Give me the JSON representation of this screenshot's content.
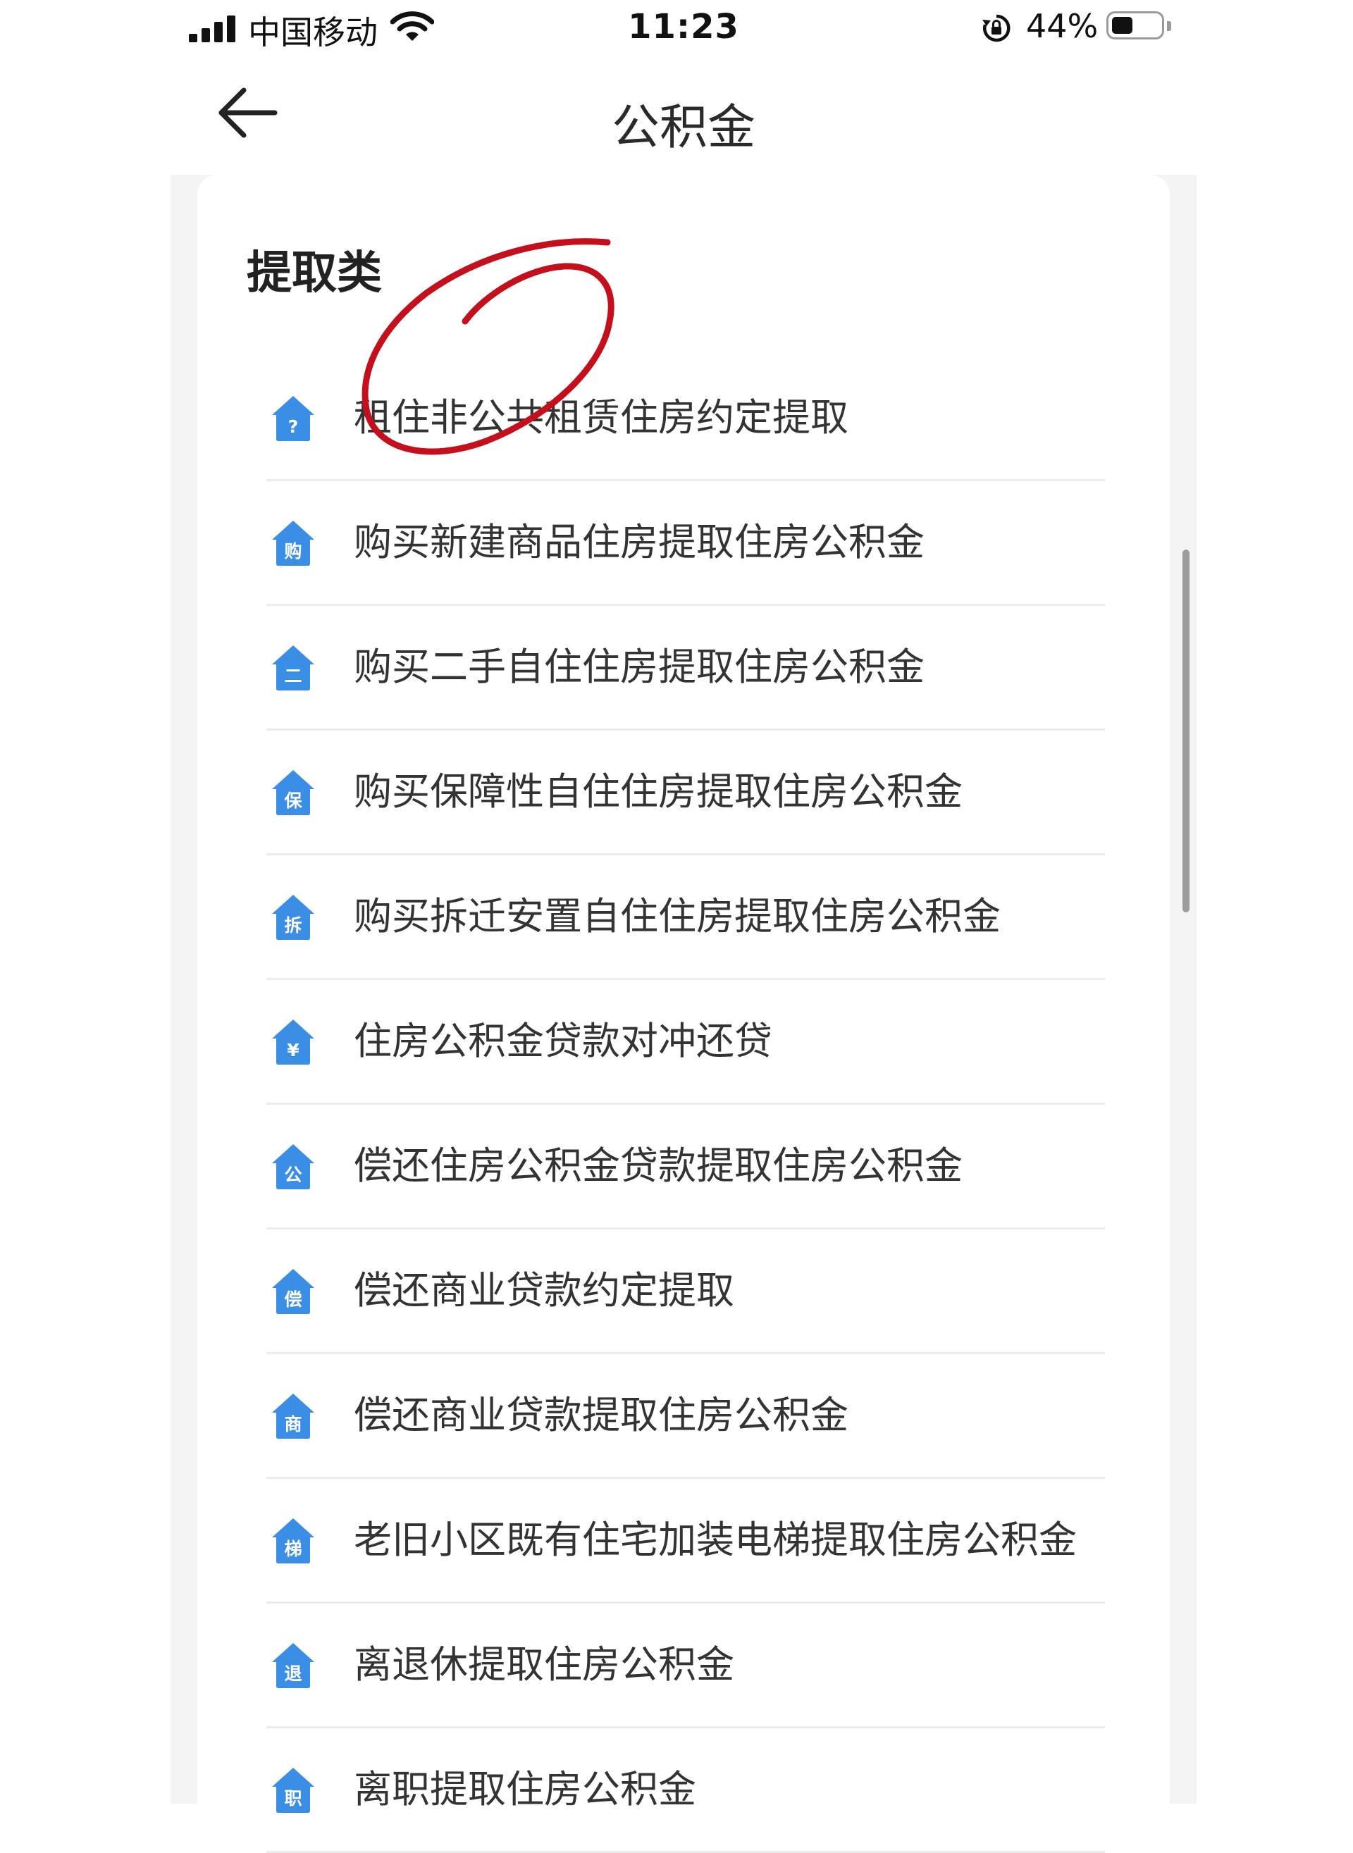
{
  "status_bar": {
    "carrier": "中国移动",
    "time": "11:23",
    "battery_percent": "44%",
    "battery_level": 0.44
  },
  "header": {
    "title": "公积金",
    "back_icon": "arrow-left-icon"
  },
  "section": {
    "title": "提取类",
    "items": [
      {
        "icon_char": "?",
        "label": "租住非公共租赁住房约定提取"
      },
      {
        "icon_char": "购",
        "label": "购买新建商品住房提取住房公积金"
      },
      {
        "icon_char": "二",
        "label": "购买二手自住住房提取住房公积金"
      },
      {
        "icon_char": "保",
        "label": "购买保障性自住住房提取住房公积金"
      },
      {
        "icon_char": "拆",
        "label": "购买拆迁安置自住住房提取住房公积金"
      },
      {
        "icon_char": "¥",
        "label": "住房公积金贷款对冲还贷"
      },
      {
        "icon_char": "公",
        "label": "偿还住房公积金贷款提取住房公积金"
      },
      {
        "icon_char": "偿",
        "label": "偿还商业贷款约定提取"
      },
      {
        "icon_char": "商",
        "label": "偿还商业贷款提取住房公积金"
      },
      {
        "icon_char": "梯",
        "label": "老旧小区既有住宅加装电梯提取住房公积金"
      },
      {
        "icon_char": "退",
        "label": "离退休提取住房公积金"
      },
      {
        "icon_char": "职",
        "label": "离职提取住房公积金"
      }
    ]
  },
  "colors": {
    "icon_blue": "#3a8ee6",
    "annotation_red": "#c4101c",
    "divider": "#ececec"
  }
}
